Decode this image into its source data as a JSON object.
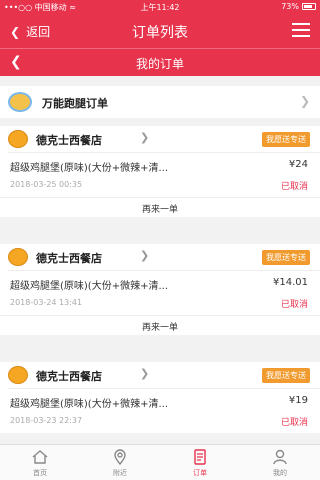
{
  "status_bar": {
    "carrier": "•••○○ 中国移动 ≈",
    "time": "上午11:42",
    "battery": "73%"
  },
  "navbar": {
    "back_label": "返回",
    "title": "订单列表"
  },
  "subbar": {
    "title": "我的订单"
  },
  "errand": {
    "label": "万能跑腿订单"
  },
  "orders": [
    {
      "shop": "德克士西餐店",
      "badge": "我愿送专送",
      "item": "超级鸡腿堡(原味)(大份+微辣+清...",
      "price": "¥24",
      "time": "2018-03-25 00:35",
      "status": "已取消",
      "reorder": "再来一单"
    },
    {
      "shop": "德克士西餐店",
      "badge": "我愿送专送",
      "item": "超级鸡腿堡(原味)(大份+微辣+清...",
      "price": "¥14.01",
      "time": "2018-03-24 13:41",
      "status": "已取消",
      "reorder": "再来一单"
    },
    {
      "shop": "德克士西餐店",
      "badge": "我愿送专送",
      "item": "超级鸡腿堡(原味)(大份+微辣+清...",
      "price": "¥19",
      "time": "2018-03-23 22:37",
      "status": "已取消"
    }
  ],
  "tabs": [
    {
      "label": "首页",
      "icon": "home-icon"
    },
    {
      "label": "附近",
      "icon": "location-icon"
    },
    {
      "label": "订单",
      "icon": "order-icon"
    },
    {
      "label": "我的",
      "icon": "user-icon"
    }
  ],
  "colors": {
    "brand": "#e8334d",
    "badge": "#f19a2e"
  }
}
